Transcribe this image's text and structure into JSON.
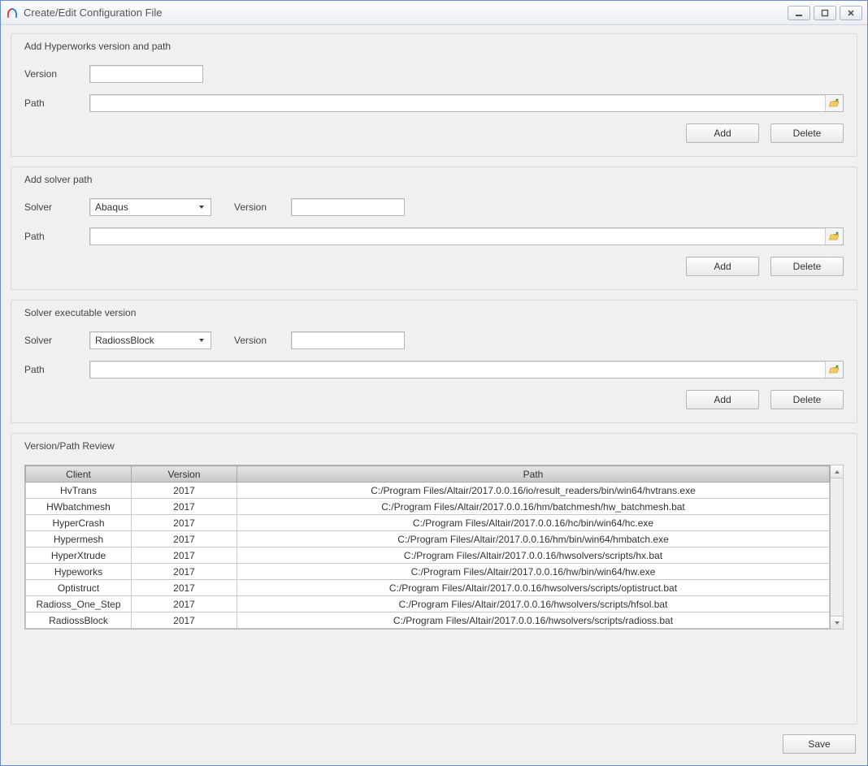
{
  "window": {
    "title": "Create/Edit Configuration File"
  },
  "group1": {
    "legend": "Add Hyperworks version and path",
    "versionLabel": "Version",
    "versionValue": "",
    "pathLabel": "Path",
    "pathValue": "",
    "addBtn": "Add",
    "deleteBtn": "Delete"
  },
  "group2": {
    "legend": "Add solver path",
    "solverLabel": "Solver",
    "solverValue": "Abaqus",
    "versionLabel": "Version",
    "versionValue": "",
    "pathLabel": "Path",
    "pathValue": "",
    "addBtn": "Add",
    "deleteBtn": "Delete"
  },
  "group3": {
    "legend": "Solver executable version",
    "solverLabel": "Solver",
    "solverValue": "RadiossBlock",
    "versionLabel": "Version",
    "versionValue": "",
    "pathLabel": "Path",
    "pathValue": "",
    "addBtn": "Add",
    "deleteBtn": "Delete"
  },
  "review": {
    "legend": "Version/Path Review",
    "headers": {
      "client": "Client",
      "version": "Version",
      "path": "Path"
    },
    "rows": [
      {
        "client": "HvTrans",
        "version": "2017",
        "path": "C:/Program Files/Altair/2017.0.0.16/io/result_readers/bin/win64/hvtrans.exe"
      },
      {
        "client": "HWbatchmesh",
        "version": "2017",
        "path": "C:/Program Files/Altair/2017.0.0.16/hm/batchmesh/hw_batchmesh.bat"
      },
      {
        "client": "HyperCrash",
        "version": "2017",
        "path": "C:/Program Files/Altair/2017.0.0.16/hc/bin/win64/hc.exe"
      },
      {
        "client": "Hypermesh",
        "version": "2017",
        "path": "C:/Program Files/Altair/2017.0.0.16/hm/bin/win64/hmbatch.exe"
      },
      {
        "client": "HyperXtrude",
        "version": "2017",
        "path": "C:/Program Files/Altair/2017.0.0.16/hwsolvers/scripts/hx.bat"
      },
      {
        "client": "Hypeworks",
        "version": "2017",
        "path": "C:/Program Files/Altair/2017.0.0.16/hw/bin/win64/hw.exe"
      },
      {
        "client": "Optistruct",
        "version": "2017",
        "path": "C:/Program Files/Altair/2017.0.0.16/hwsolvers/scripts/optistruct.bat"
      },
      {
        "client": "Radioss_One_Step",
        "version": "2017",
        "path": "C:/Program Files/Altair/2017.0.0.16/hwsolvers/scripts/hfsol.bat"
      },
      {
        "client": "RadiossBlock",
        "version": "2017",
        "path": "C:/Program Files/Altair/2017.0.0.16/hwsolvers/scripts/radioss.bat"
      }
    ]
  },
  "footer": {
    "saveBtn": "Save"
  }
}
